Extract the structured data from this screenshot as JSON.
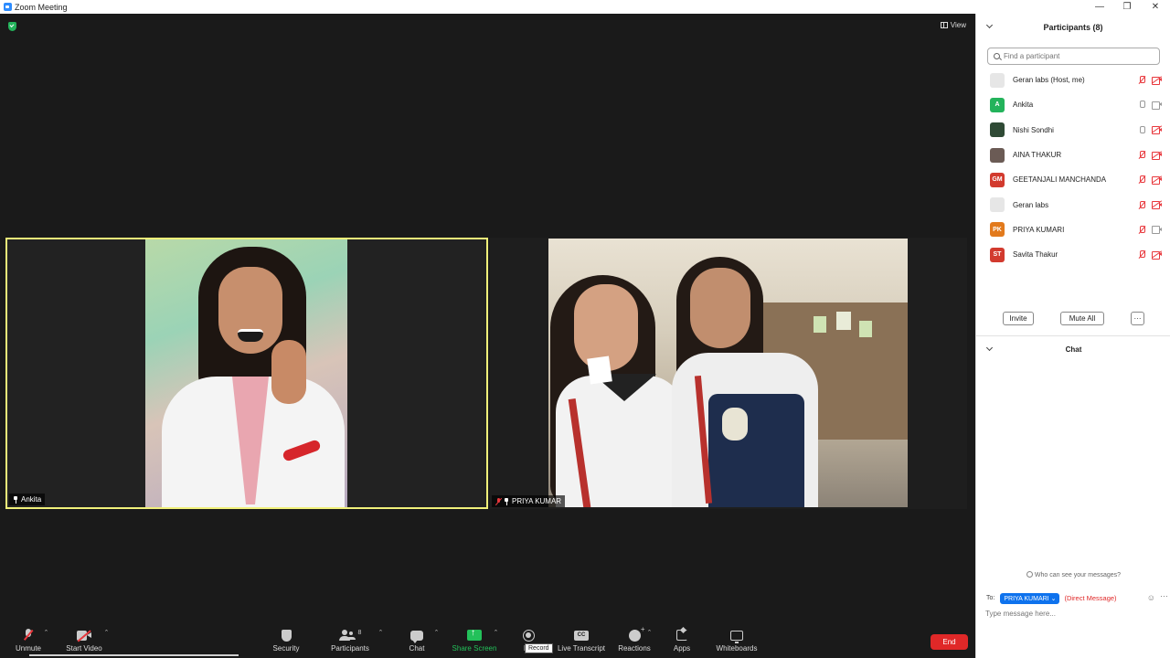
{
  "window": {
    "title": "Zoom Meeting"
  },
  "stage": {
    "view_label": "View"
  },
  "tiles": [
    {
      "name": "Ankita"
    },
    {
      "name": "PRIYA KUMAR"
    }
  ],
  "toolbar": {
    "unmute": "Unmute",
    "start_video": "Start Video",
    "security": "Security",
    "participants": "Participants",
    "participants_count": "8",
    "chat": "Chat",
    "share_screen": "Share Screen",
    "record": "Re",
    "record_tooltip": "Record",
    "live_transcript": "Live Transcript",
    "cc_icon_text": "CC",
    "reactions": "Reactions",
    "apps": "Apps",
    "whiteboards": "Whiteboards",
    "end": "End"
  },
  "panel": {
    "participants_title": "Participants (8)",
    "search_placeholder": "Find a participant",
    "participants": [
      {
        "name": "Geran labs (Host, me)",
        "avatar": "",
        "avatar_color": "#e6e6e6",
        "mic_muted": true,
        "cam_muted": true
      },
      {
        "name": "Ankita",
        "avatar": "A",
        "avatar_color": "#23b35b",
        "mic_muted": false,
        "cam_muted": false
      },
      {
        "name": "Nishi Sondhi",
        "avatar": "",
        "avatar_color": "#2f4a35",
        "mic_muted": false,
        "cam_muted": true
      },
      {
        "name": "AINA THAKUR",
        "avatar": "",
        "avatar_color": "#6b5b55",
        "mic_muted": true,
        "cam_muted": true
      },
      {
        "name": "GEETANJALI MANCHANDA",
        "avatar": "GM",
        "avatar_color": "#d23a2e",
        "mic_muted": true,
        "cam_muted": true
      },
      {
        "name": "Geran labs",
        "avatar": "",
        "avatar_color": "#e6e6e6",
        "mic_muted": true,
        "cam_muted": true
      },
      {
        "name": "PRIYA KUMARI",
        "avatar": "PK",
        "avatar_color": "#e27a1c",
        "mic_muted": true,
        "cam_muted": false
      },
      {
        "name": "Savita Thakur",
        "avatar": "ST",
        "avatar_color": "#d23a2e",
        "mic_muted": true,
        "cam_muted": true
      }
    ],
    "invite": "Invite",
    "mute_all": "Mute All",
    "more": "···",
    "chat_title": "Chat",
    "who_can_see": "Who can see your messages?",
    "to_label": "To:",
    "to_recipient": "PRIYA KUMARI",
    "direct_message": "(Direct Message)",
    "message_placeholder": "Type message here..."
  },
  "colors": {
    "active_speaker_border": "#f0f07a",
    "end_button": "#e02828",
    "share_green": "#23c15a",
    "chip_blue": "#0e72ed"
  }
}
